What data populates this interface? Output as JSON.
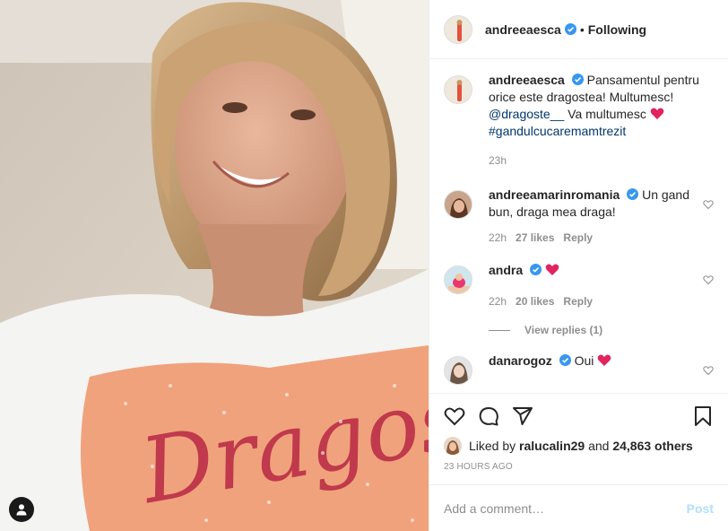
{
  "post": {
    "author": "andreeaesca",
    "follow_status": "Following",
    "separator": "•"
  },
  "caption": {
    "author": "andreeaesca",
    "text_main": "Pansamentul pentru orice este dragostea! Multumesc!",
    "mention": "@dragoste__",
    "text_after_mention": "Va multumesc",
    "hashtag": "#gandulcucaremamtrezit",
    "time": "23h"
  },
  "comments": [
    {
      "user": "andreeamarinromania",
      "text": "Un gand bun, draga mea draga!",
      "time": "22h",
      "likes": "27 likes",
      "reply": "Reply"
    },
    {
      "user": "andra",
      "text": "",
      "time": "22h",
      "likes": "20 likes",
      "reply": "Reply",
      "view_replies": "View replies (1)"
    },
    {
      "user": "danarogoz",
      "text": "Oui"
    }
  ],
  "likes": {
    "prefix": "Liked by",
    "user": "ralucalin29",
    "middle": "and",
    "others": "24,863 others"
  },
  "timestamp": "23 HOURS AGO",
  "add_comment": {
    "placeholder": "Add a comment…",
    "post_label": "Post"
  },
  "colors": {
    "verified": "#3897f0",
    "link": "#00376b",
    "heart": "#ed4956",
    "post_disabled": "#b2dffc",
    "meta": "#8e8e8e"
  },
  "icons": [
    "heart-icon",
    "comment-icon",
    "share-icon",
    "bookmark-icon",
    "verified-icon",
    "user-tag-icon"
  ],
  "photo_alt": "Dragoste"
}
